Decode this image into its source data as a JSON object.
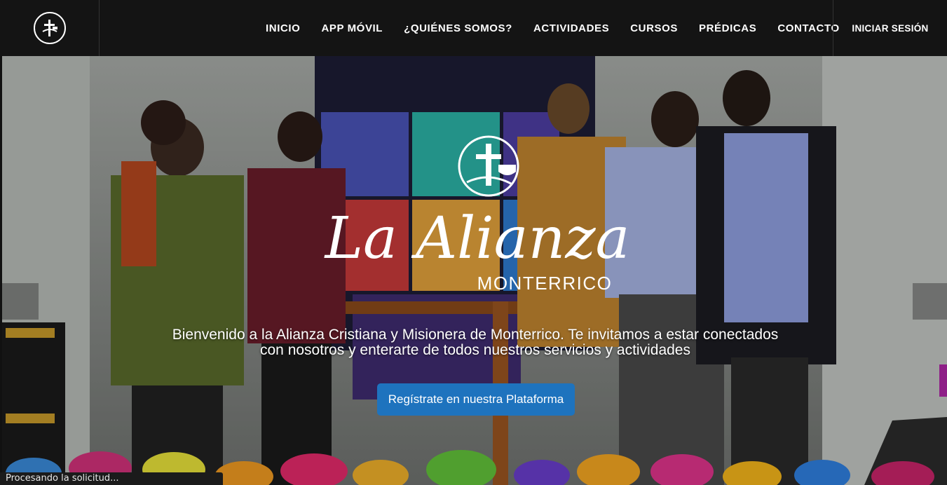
{
  "nav": {
    "items": [
      {
        "label": "INICIO"
      },
      {
        "label": "APP MÓVIL"
      },
      {
        "label": "¿QUIÉNES SOMOS?"
      },
      {
        "label": "ACTIVIDADES"
      },
      {
        "label": "CURSOS"
      },
      {
        "label": "PRÉDICAS"
      },
      {
        "label": "CONTACTO"
      }
    ],
    "login": "INICIAR SESIÓN"
  },
  "hero": {
    "logo_script": "La Alianza",
    "logo_subtitle": "MONTERRICO",
    "welcome_line1": "Bienvenido a la Alianza Cristiana y Misionera de Monterrico. Te invitamos a estar conectados",
    "welcome_line2": "con nosotros y enterarte de todos nuestros servicios y actividades",
    "cta_label": "Regístrate en nuestra Plataforma"
  },
  "status_bar": {
    "text": "Procesando la solicitud..."
  },
  "colors": {
    "navbar": "#141414",
    "cta": "#1e73be",
    "side_tab": "#8e1f87"
  }
}
